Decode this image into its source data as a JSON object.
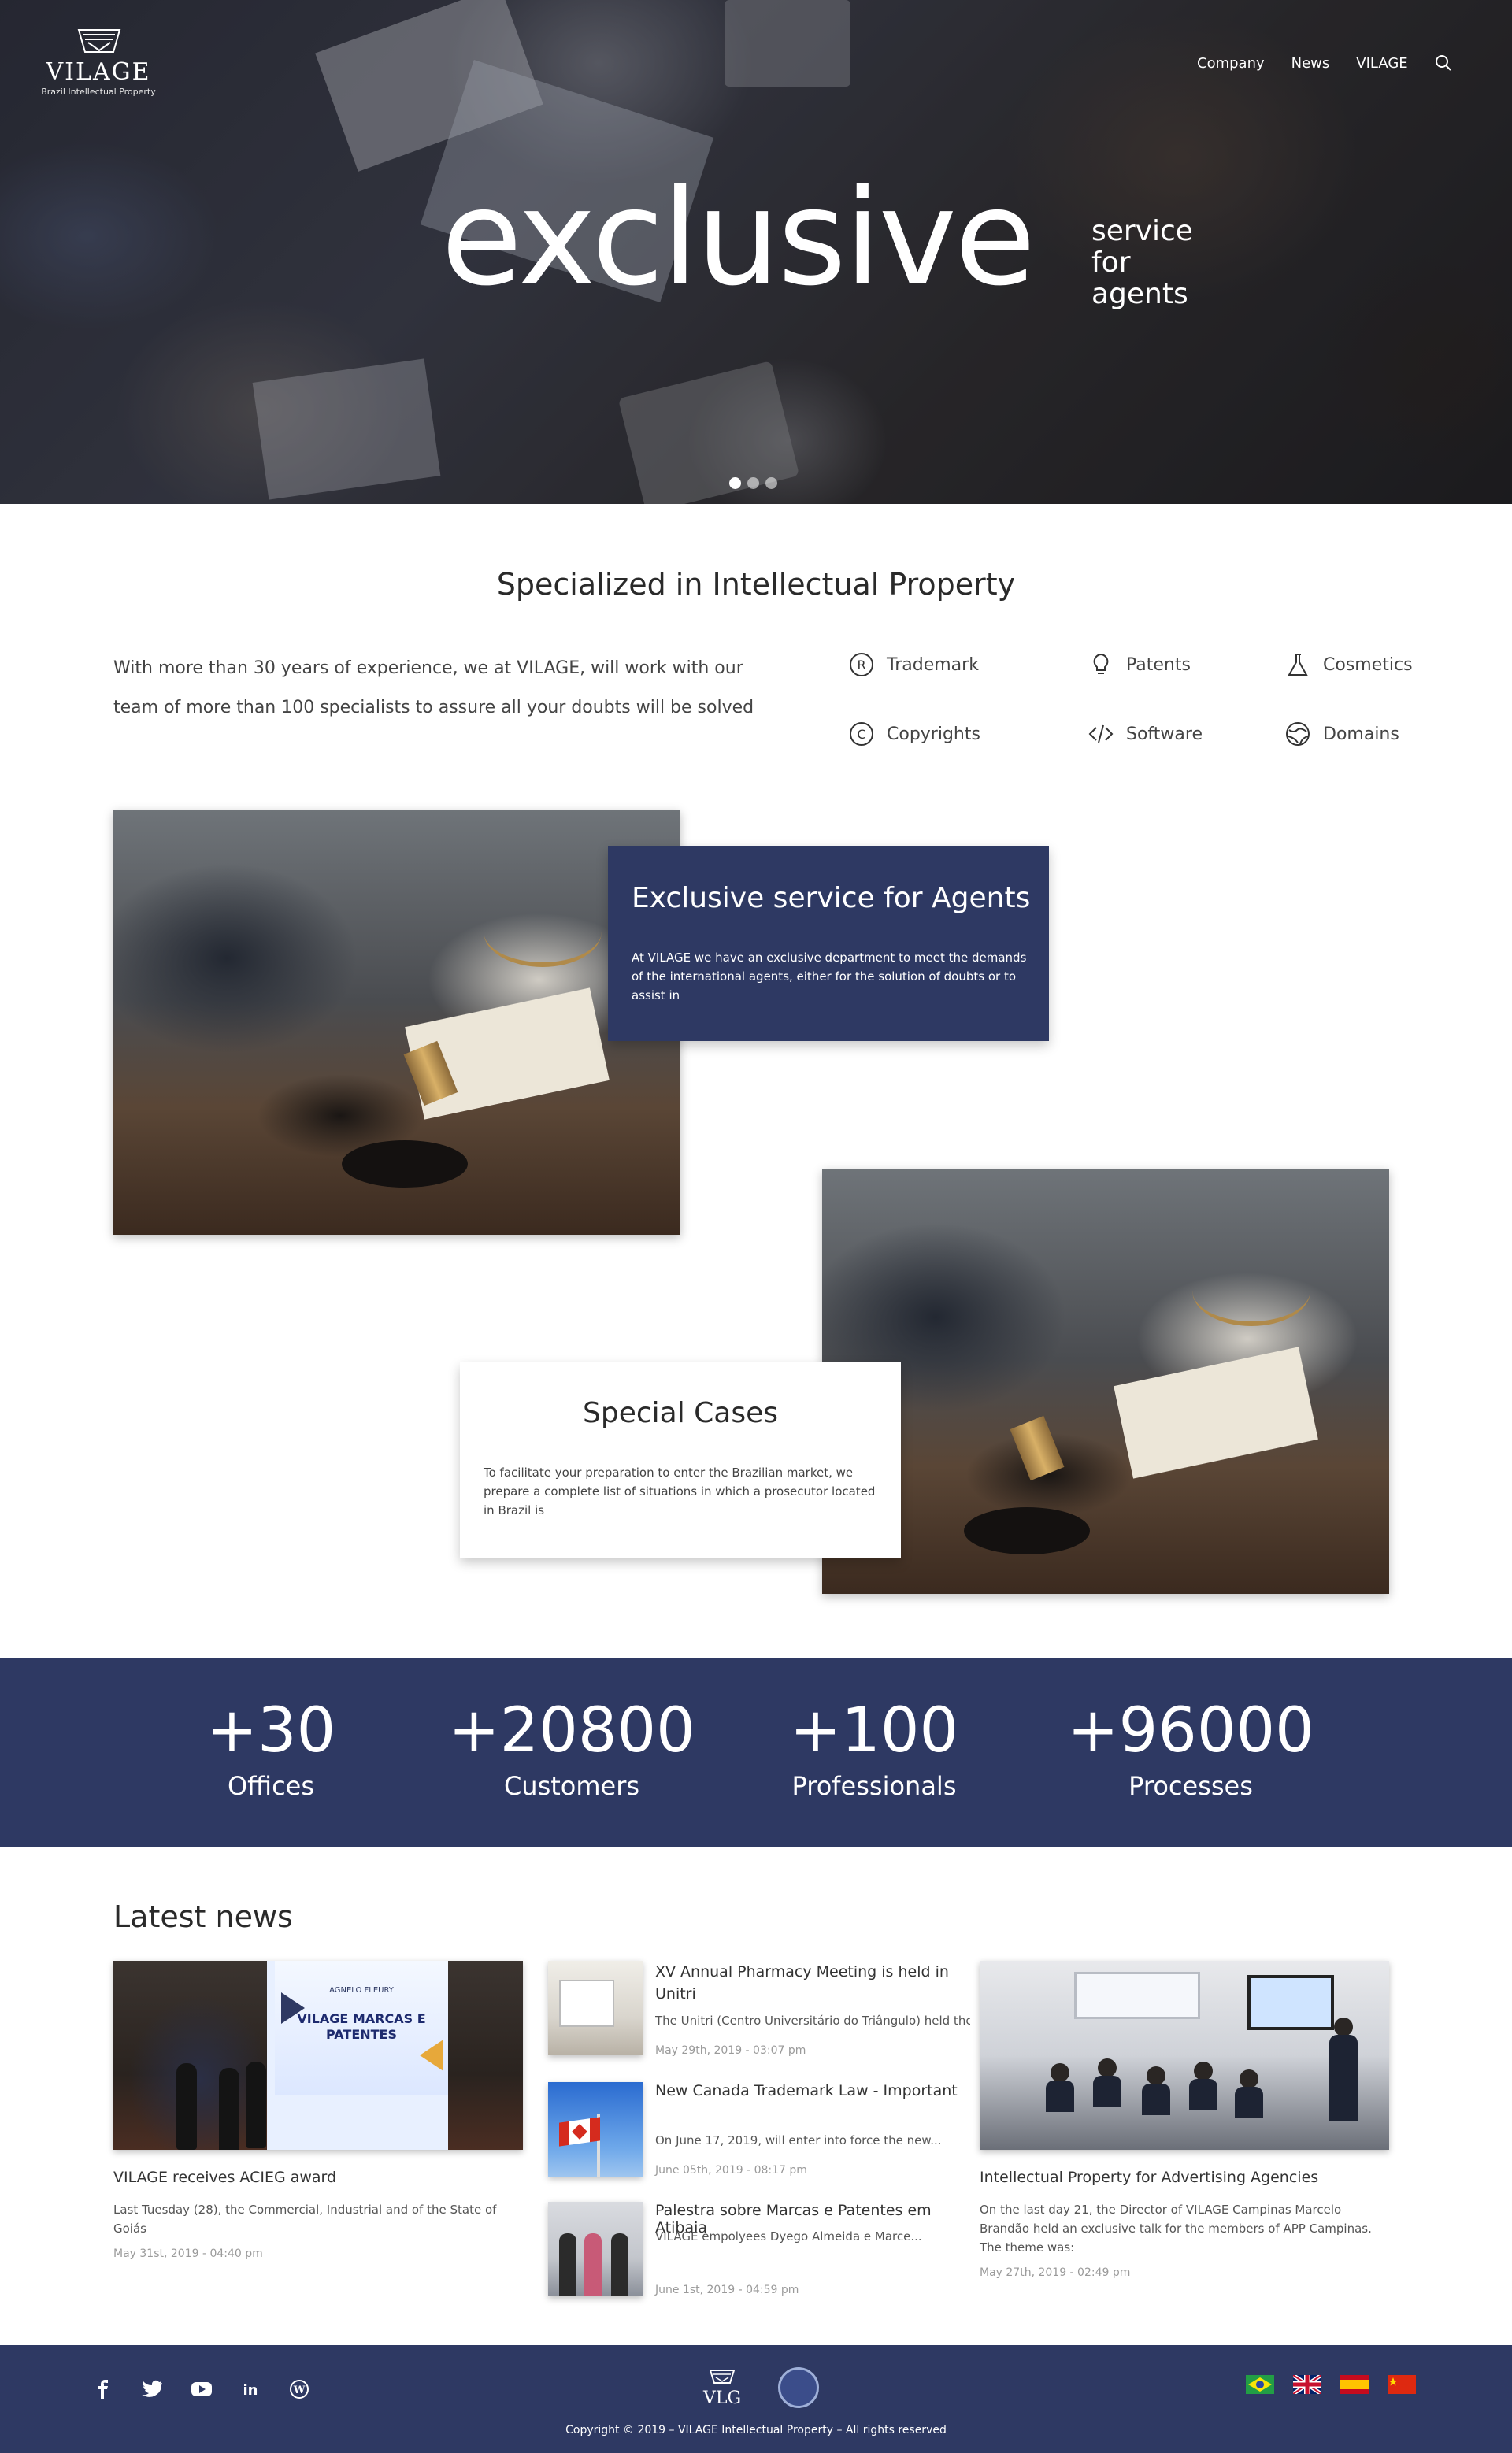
{
  "header": {
    "logo": {
      "brand": "VILAGE",
      "tagline": "Brazil Intellectual Property"
    },
    "nav": [
      "Company",
      "News",
      "VILAGE"
    ],
    "search_icon": "search-icon"
  },
  "hero": {
    "big_word": "exclusive",
    "side": [
      "service",
      "for",
      "agents"
    ],
    "slides": 3,
    "active_slide": 1
  },
  "specialized": {
    "title": "Specialized in Intellectual Property",
    "text": "With more than 30 years of experience, we at VILAGE, will work with our team of more than 100 specialists to assure all your doubts will be solved",
    "services": [
      {
        "label": "Trademark",
        "icon": "registered-icon"
      },
      {
        "label": "Patents",
        "icon": "lightbulb-icon"
      },
      {
        "label": "Cosmetics",
        "icon": "flask-icon"
      },
      {
        "label": "Copyrights",
        "icon": "copyright-icon"
      },
      {
        "label": "Software",
        "icon": "code-icon"
      },
      {
        "label": "Domains",
        "icon": "globe-icon"
      }
    ]
  },
  "features": {
    "agents": {
      "title": "Exclusive service for Agents",
      "text": "At VILAGE we have an exclusive department to meet the demands of the international agents, either for the solution of doubts or to assist in"
    },
    "special": {
      "title": "Special Cases",
      "text": "To facilitate your preparation to enter the Brazilian market, we prepare a complete list of situations in which a prosecutor located in Brazil is"
    }
  },
  "stats": [
    {
      "value": "+30",
      "label": "Offices"
    },
    {
      "value": "+20800",
      "label": "Customers"
    },
    {
      "value": "+100",
      "label": "Professionals"
    },
    {
      "value": "+96000",
      "label": "Processes"
    }
  ],
  "news": {
    "title": "Latest news",
    "featured_left": {
      "image_small_text": "AGNELO FLEURY",
      "image_main_text": "VILAGE MARCAS E PATENTES",
      "caption": "VILAGE receives ACIEG award",
      "excerpt": "Last Tuesday (28), the Commercial, Industrial and of the State of Goiás",
      "date": "May 31st, 2019 - 04:40 pm"
    },
    "list": [
      {
        "title": "XV Annual Pharmacy Meeting is held in Unitri",
        "excerpt": "The Unitri (Centro Universitário do Triângulo) held the...",
        "date": "May 29th, 2019 - 03:07 pm"
      },
      {
        "title": "New Canada Trademark Law - Important",
        "excerpt": "On June 17, 2019, will enter into force the new...",
        "date": "June 05th, 2019 - 08:17 pm"
      },
      {
        "title": "Palestra sobre Marcas e Patentes em Atibaia",
        "excerpt": "VILAGE empolyees Dyego Almeida e Marce...",
        "date": "June 1st, 2019 - 04:59 pm"
      }
    ],
    "featured_right": {
      "caption": "Intellectual Property for Advertising Agencies",
      "excerpt": "On the last day 21, the Director of VILAGE Campinas Marcelo Brandão held an exclusive talk for the members of APP Campinas. The theme was:",
      "date": "May 27th, 2019 - 02:49 pm"
    }
  },
  "footer": {
    "social": [
      "facebook-icon",
      "twitter-icon",
      "youtube-icon",
      "linkedin-icon",
      "wordpress-icon"
    ],
    "logo": "VLG",
    "flags": [
      "brazil-flag-icon",
      "uk-flag-icon",
      "spain-flag-icon",
      "china-flag-icon"
    ],
    "copyright": "Copyright © 2019 – VILAGE Intellectual Property – All rights reserved"
  },
  "colors": {
    "brand_navy": "#2e3963",
    "white": "#ffffff"
  }
}
